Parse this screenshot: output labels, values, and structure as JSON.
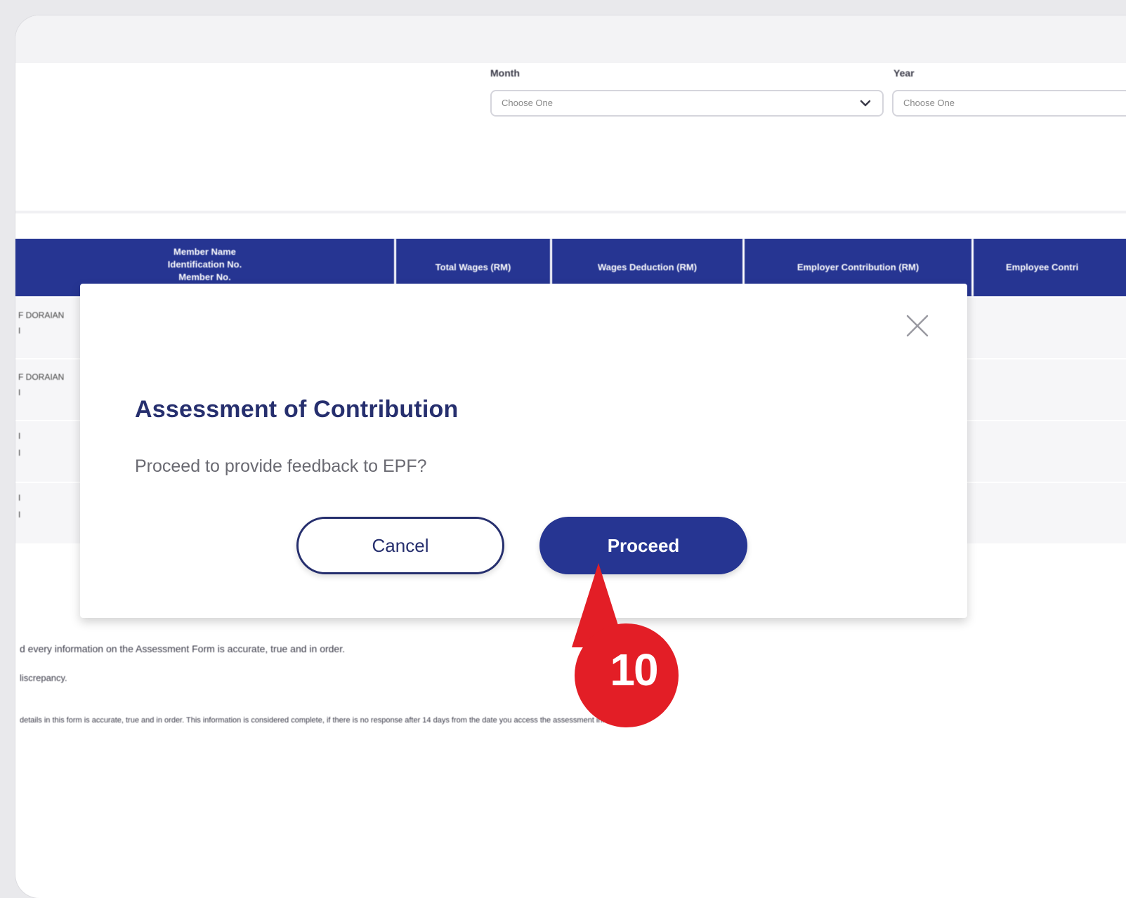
{
  "filters": {
    "month_label": "Month",
    "month_value": "Choose One",
    "year_label": "Year",
    "year_value": "Choose One"
  },
  "table": {
    "headers": [
      "Member Name\nIdentification No.\nMember No.",
      "Total Wages (RM)",
      "Wages Deduction (RM)",
      "Employer Contribution (RM)",
      "Employee Contri"
    ],
    "rows": [
      {
        "line1": "F DORAIAN",
        "line2": "I"
      },
      {
        "line1": "F DORAIAN",
        "line2": "I"
      },
      {
        "line1": "I",
        "line2": "I"
      },
      {
        "line1": "I",
        "line2": "I"
      }
    ]
  },
  "footer": {
    "line1": "d every information on the Assessment Form is accurate, true and in order.",
    "line2": "liscrepancy.",
    "line3": "details in this form is accurate, true and in order. This information is considered complete, if there is no response after 14 days from the date you access the assessment information."
  },
  "modal": {
    "title": "Assessment of Contribution",
    "message": "Proceed to provide feedback to EPF?",
    "cancel_label": "Cancel",
    "proceed_label": "Proceed"
  },
  "annotation": {
    "step_number": "10",
    "color": "#e31e26"
  },
  "colors": {
    "primary": "#263592",
    "title": "#262f6e"
  }
}
